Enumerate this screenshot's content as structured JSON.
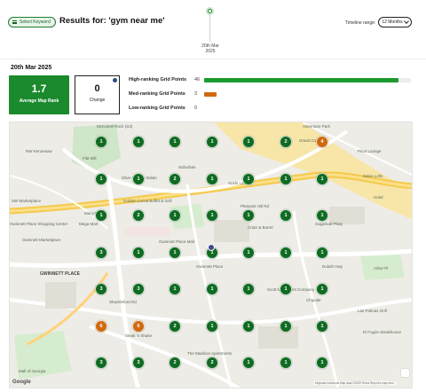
{
  "header": {
    "select_keyword_label": "Select Keyword",
    "results_title": "Results for: 'gym near me'",
    "timeline_label": "Timeline range:",
    "timeline_value": "12 Months"
  },
  "timeline": {
    "date_line1": "20th Mar",
    "date_line2": "2025"
  },
  "summary": {
    "date_heading": "20th Mar 2025",
    "average_map_rank": "1.7",
    "average_map_rank_label": "Average Map Rank",
    "change_value": "0",
    "change_label": "Change"
  },
  "rank_breakdown": [
    {
      "label": "High-ranking Grid Points",
      "count": "46",
      "fraction": 0.94,
      "color": "#1b9a2f"
    },
    {
      "label": "Med-ranking Grid Points",
      "count": "3",
      "fraction": 0.06,
      "color": "#d0690f"
    },
    {
      "label": "Low-ranking Grid Points",
      "count": "0",
      "fraction": 0.0,
      "color": "#c0392b"
    }
  ],
  "grid": {
    "rows": [
      [
        "1",
        "1",
        "1",
        "1",
        "1",
        "2",
        "4"
      ],
      [
        "1",
        "1",
        "2",
        "1",
        "1",
        "1",
        "1"
      ],
      [
        "1",
        "2",
        "1",
        "1",
        "1",
        "1",
        "1"
      ],
      [
        "3",
        "1",
        "1",
        "1",
        "1",
        "1",
        "1"
      ],
      [
        "3",
        "3",
        "1",
        "1",
        "1",
        "1",
        "1"
      ],
      [
        "6",
        "6",
        "2",
        "1",
        "1",
        "1",
        "1"
      ],
      [
        "3",
        "3",
        "2",
        "2",
        "1",
        "1",
        "1"
      ]
    ],
    "high_color": "#0f6b22",
    "med_color": "#d0690f"
  },
  "map": {
    "labels": [
      "McCamel Rock (S3)",
      "Flat Mill",
      "NW Kennesaw",
      "Adventure Park",
      "Grand Canyon",
      "Pinot Lounge",
      "Salon Lofts",
      "Hotel",
      "SW Marketplace",
      "Gwinnett Marketplace",
      "Mega Mart",
      "Macy's",
      "Suburban",
      "Olive Garden Italian",
      "Golden Corral Buffet & Grill",
      "Crate & Barrel",
      "Gwinnett Place",
      "Sushi Lovers",
      "Scott Monument Company",
      "Mall of Georgia",
      "Steak 'n Shake",
      "The Madison Apartments",
      "Chipotle",
      "Las Palmas Grill",
      "El Fogón Steakhouse",
      "Gwinnett Place Mall",
      "Gwinnett Place Shopping Center",
      "Sugarloaf Pkwy",
      "GWINNETT PLACE",
      "Pleasant Hill Rd",
      "Shackleford Rd",
      "Duluth Hwy",
      "Arbor Pl"
    ],
    "google_logo_text": "Google",
    "attribution": "Keyboard shortcuts   Map data ©2025   Terms   Report a map error"
  }
}
